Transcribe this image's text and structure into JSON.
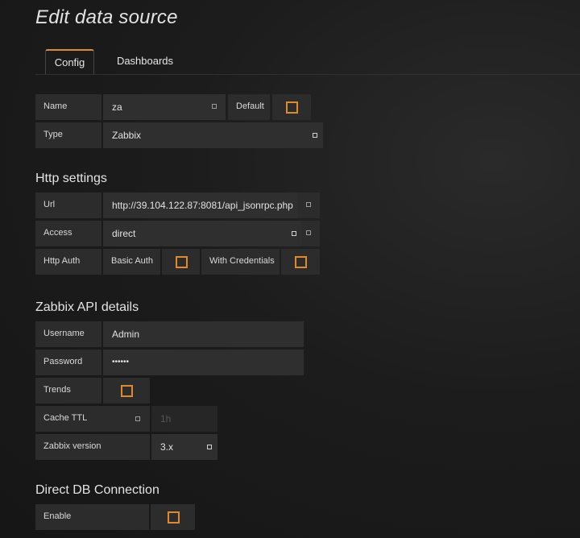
{
  "page": {
    "title": "Edit data source"
  },
  "tabs": [
    {
      "label": "Config"
    },
    {
      "label": "Dashboards"
    }
  ],
  "basic": {
    "name_label": "Name",
    "name_value": "za",
    "default_label": "Default",
    "type_label": "Type",
    "type_value": "Zabbix"
  },
  "http": {
    "title": "Http settings",
    "url_label": "Url",
    "url_value": "http://39.104.122.87:8081/api_jsonrpc.php",
    "access_label": "Access",
    "access_value": "direct",
    "auth_label": "Http Auth",
    "basic_auth_label": "Basic Auth",
    "credentials_label": "With Credentials"
  },
  "zabbix": {
    "title": "Zabbix API details",
    "username_label": "Username",
    "username_value": "Admin",
    "password_label": "Password",
    "password_value": "••••••",
    "trends_label": "Trends",
    "cache_label": "Cache TTL",
    "cache_placeholder": "1h",
    "version_label": "Zabbix version",
    "version_value": "3.x"
  },
  "db": {
    "title": "Direct DB Connection",
    "enable_label": "Enable"
  },
  "colors": {
    "accent": "#e08a2c",
    "label_bg": "#2c2c2c",
    "field_bg": "#2f2f2f",
    "background": "#1b1b1b"
  },
  "icons": [
    "info-icon",
    "checkbox-icon",
    "dropdown-icon"
  ]
}
